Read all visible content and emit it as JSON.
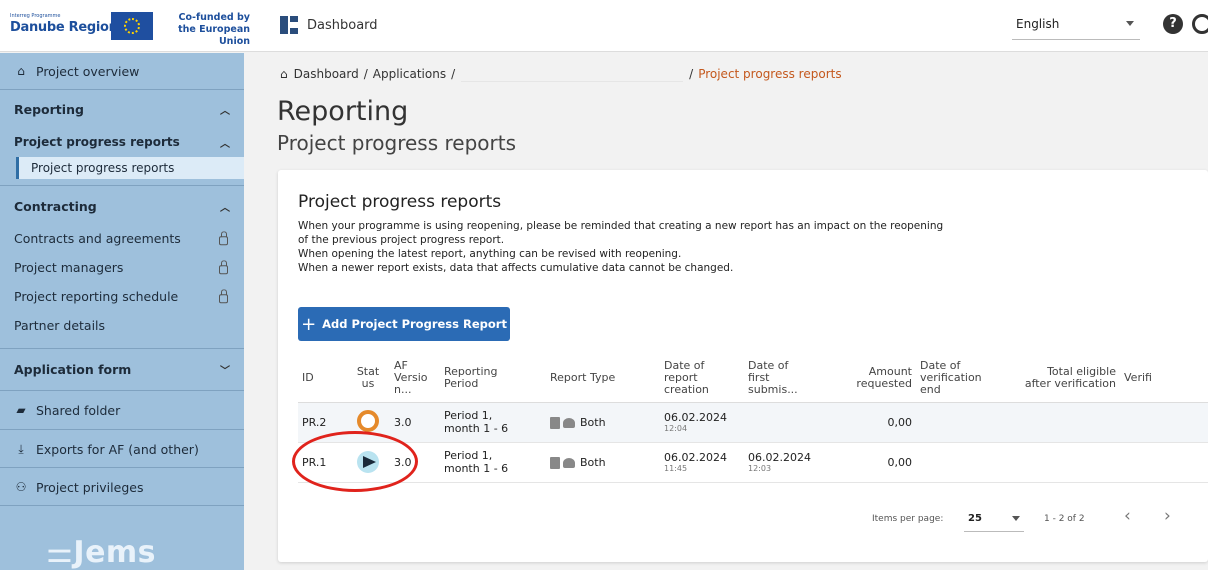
{
  "header": {
    "logo_programme": "Interreg Programme",
    "logo_name": "Danube Region",
    "eu_line1": "Co-funded by",
    "eu_line2": "the European Union",
    "dashboard_label": "Dashboard",
    "language": "English"
  },
  "sidebar": {
    "project_overview": "Project overview",
    "reporting": "Reporting",
    "project_progress_reports": "Project progress reports",
    "project_progress_reports_sub": "Project progress reports",
    "contracting": "Contracting",
    "contracts_agreements": "Contracts and agreements",
    "project_managers": "Project managers",
    "reporting_schedule": "Project reporting schedule",
    "partner_details": "Partner details",
    "application_form": "Application form",
    "shared_folder": "Shared folder",
    "exports": "Exports for AF (and other)",
    "privileges": "Project privileges",
    "brand": "Jems"
  },
  "breadcrumb": {
    "dashboard": "Dashboard",
    "applications": "Applications",
    "current": "Project progress reports"
  },
  "page": {
    "title": "Reporting",
    "subtitle": "Project progress reports"
  },
  "card": {
    "title": "Project progress reports",
    "desc_line1": "When your programme is using reopening, please be reminded that creating a new report has an impact on the reopening",
    "desc_line2": "of the previous project progress report.",
    "desc_line3": "When opening the latest report, anything can be revised with reopening.",
    "desc_line4": "When a newer report exists, data that affects cumulative data cannot be changed.",
    "add_button": "Add Project Progress Report"
  },
  "table": {
    "headers": {
      "id": "ID",
      "status_1": "Stat",
      "status_2": "us",
      "af_1": "AF",
      "af_2": "Versio",
      "af_3": "n...",
      "period_1": "Reporting",
      "period_2": "Period",
      "type": "Report Type",
      "creation_1": "Date of",
      "creation_2": "report",
      "creation_3": "creation",
      "first_sub_1": "Date of",
      "first_sub_2": "first",
      "first_sub_3": "submis...",
      "amount_1": "Amount",
      "amount_2": "requested",
      "verif_end_1": "Date of",
      "verif_end_2": "verification",
      "verif_end_3": "end",
      "total_1": "Total eligible",
      "total_2": "after verification",
      "verif": "Verifi"
    },
    "rows": [
      {
        "id": "PR.2",
        "status": "draft",
        "af_version": "3.0",
        "period_1": "Period 1,",
        "period_2": "month 1 - 6",
        "type": "Both",
        "created_date": "06.02.2024",
        "created_time": "12:04",
        "first_sub_date": "",
        "first_sub_time": "",
        "amount": "0,00"
      },
      {
        "id": "PR.1",
        "status": "submitted",
        "af_version": "3.0",
        "period_1": "Period 1,",
        "period_2": "month 1 - 6",
        "type": "Both",
        "created_date": "06.02.2024",
        "created_time": "11:45",
        "first_sub_date": "06.02.2024",
        "first_sub_time": "12:03",
        "amount": "0,00"
      }
    ]
  },
  "pager": {
    "label": "Items per page:",
    "size": "25",
    "range": "1 - 2 of 2",
    "prev": "‹",
    "next": "›"
  },
  "colors": {
    "sidebar_bg": "#9ec0dc",
    "primary": "#2b6bb5",
    "breadcrumb_active": "#c4581d",
    "annotation": "#e0231c"
  }
}
